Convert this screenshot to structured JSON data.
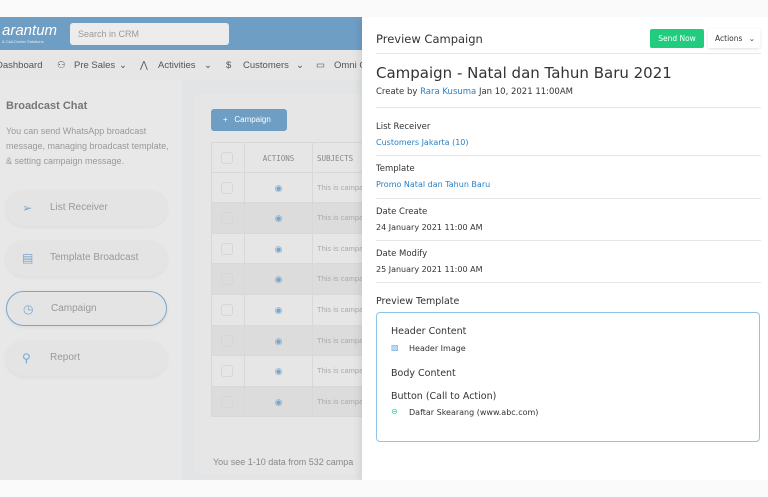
{
  "header": {
    "logo": "arantum",
    "logo_sub": "& Call-Center Solutions",
    "search_placeholder": "Search in CRM"
  },
  "nav": [
    {
      "label": "Dashboard"
    },
    {
      "label": "Pre Sales"
    },
    {
      "label": "Activities"
    },
    {
      "label": "Customers"
    },
    {
      "label": "Omni C"
    }
  ],
  "sidebar": {
    "title": "Broadcast Chat",
    "description": "You can send WhatsApp broadcast message, managing broadcast template, & setting campaign message.",
    "items": [
      {
        "label": "List Receiver",
        "icon": "send-icon"
      },
      {
        "label": "Template Broadcast",
        "icon": "archive-icon"
      },
      {
        "label": "Campaign",
        "icon": "clock-icon",
        "active": true
      },
      {
        "label": "Report",
        "icon": "route-icon"
      }
    ]
  },
  "main": {
    "add_button": "Campaign",
    "columns": [
      "ACTIONS",
      "SUBJECTS"
    ],
    "rows": [
      "This is campa",
      "This is campa",
      "This is campa",
      "This is campa",
      "This is campa",
      "This is campa",
      "This is campa",
      "This is campa"
    ],
    "footer": "You see 1-10 data from 532 campa"
  },
  "panel": {
    "title": "Preview Campaign",
    "send_now": "Send Now",
    "actions": "Actions",
    "campaign_title": "Campaign - Natal dan Tahun Baru 2021",
    "created_prefix": "Create by",
    "created_by": "Rara Kusuma",
    "created_at": "Jan 10, 2021 11:00AM",
    "list_receiver_label": "List Receiver",
    "list_receiver": "Customers Jakarta (10)",
    "template_label": "Template",
    "template": "Promo Natal dan Tahun Baru",
    "date_create_label": "Date Create",
    "date_create": "24 January 2021 11:00 AM",
    "date_modify_label": "Date Modify",
    "date_modify": "25 January 2021 11:00 AM",
    "preview_label": "Preview Template",
    "header_content": "Header Content",
    "header_image": "Header Image",
    "body_content": "Body Content",
    "cta_label": "Button (Call to Action)",
    "cta": "Daftar Skearang (www.abc.com)"
  },
  "colors": {
    "primary": "#6f9ec4",
    "send": "#22cc7f",
    "link": "#2a7fc4"
  }
}
